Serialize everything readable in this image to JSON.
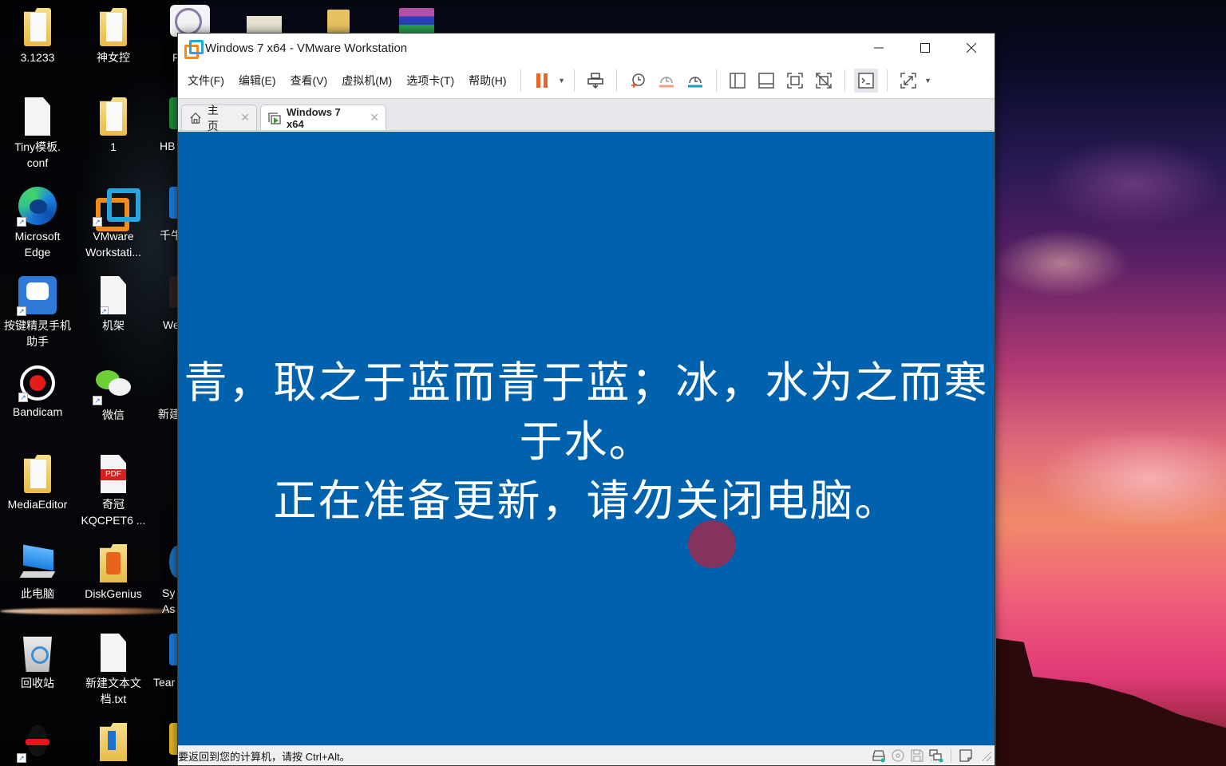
{
  "desktop": {
    "icons_col1": [
      {
        "label": "3.1233",
        "icon": "folder-icon"
      },
      {
        "label": "Tiny模板.\nconf",
        "icon": "file-icon"
      },
      {
        "label": "Microsoft\nEdge",
        "icon": "edge-icon",
        "shortcut": true
      },
      {
        "label": "按键精灵手机\n助手",
        "icon": "robot-app-icon",
        "shortcut": true
      },
      {
        "label": "Bandicam",
        "icon": "bandicam-icon",
        "shortcut": true
      },
      {
        "label": "MediaEditor",
        "icon": "folder-icon"
      },
      {
        "label": "此电脑",
        "icon": "computer-icon"
      },
      {
        "label": "回收站",
        "icon": "recycle-bin-icon"
      },
      {
        "label": "",
        "icon": "qq-icon",
        "shortcut": true
      }
    ],
    "icons_col2": [
      {
        "label": "神女控",
        "icon": "folder-icon"
      },
      {
        "label": "1",
        "icon": "folder-icon"
      },
      {
        "label": "VMware\nWorkstati...",
        "icon": "vmware-icon",
        "shortcut": true
      },
      {
        "label": "机架",
        "icon": "file-icon",
        "shortcut": true
      },
      {
        "label": "微信",
        "icon": "wechat-icon",
        "shortcut": true
      },
      {
        "label": "奇冠\nKQCPET6 ...",
        "icon": "pdf-icon"
      },
      {
        "label": "DiskGenius",
        "icon": "diskgenius-icon"
      },
      {
        "label": "新建文本文\n档.txt",
        "icon": "text-file-icon"
      },
      {
        "label": "",
        "icon": "folder-icon"
      }
    ],
    "icons_col3_partial": [
      "F",
      "HB",
      "千牛",
      "We",
      "新建",
      "Sy\nAs",
      "Tear"
    ]
  },
  "window": {
    "title": "Windows 7 x64 - VMware Workstation",
    "controls": {
      "minimize": "minimize",
      "maximize": "maximize",
      "close": "close"
    }
  },
  "menu": [
    "文件(F)",
    "编辑(E)",
    "查看(V)",
    "虚拟机(M)",
    "选项卡(T)",
    "帮助(H)"
  ],
  "toolbar": {
    "buttons": [
      "pause-icon",
      "send-ctrl-alt-del-icon",
      "snapshot-take-icon",
      "snapshot-revert-icon",
      "snapshot-manager-icon",
      "show-library-icon",
      "show-thumbnail-bar-icon",
      "full-screen-icon",
      "unity-icon",
      "console-view-icon",
      "stretch-guest-icon"
    ]
  },
  "tabs": [
    {
      "label": "主页",
      "icon": "home-icon"
    },
    {
      "label": "Windows 7 x64",
      "icon": "vm-running-icon",
      "active": true
    }
  ],
  "vm_screen": {
    "background": "#0061ad",
    "message_lines": [
      "青，取之于蓝而青于蓝；冰，水为之而寒",
      "于水。",
      "正在准备更新，请勿关闭电脑。"
    ]
  },
  "statusbar": {
    "text": "要返回到您的计算机，请按 Ctrl+Alt。",
    "devices": [
      "hard-disk-icon",
      "cd-dvd-icon",
      "floppy-icon",
      "network-adapter-icon",
      "message-log-icon"
    ]
  },
  "colors": {
    "vm_blue": "#0061ad",
    "pause_orange": "#e8662a",
    "snapshot_teal": "#1a9ec0",
    "cursor_highlight": "#8b2f5a"
  }
}
